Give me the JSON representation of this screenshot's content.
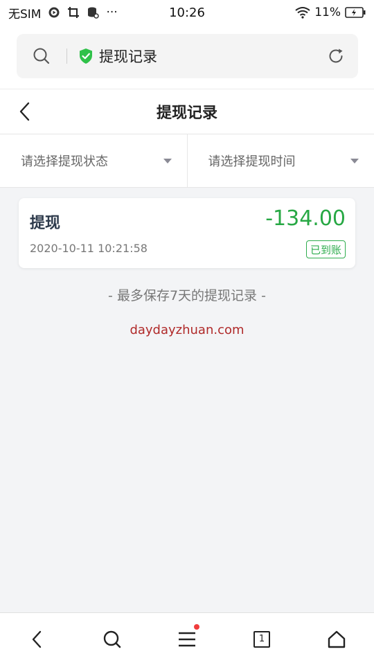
{
  "status_bar": {
    "carrier": "无SIM",
    "time": "10:26",
    "battery": "11%",
    "icons": [
      "media-icon",
      "screenshot-icon",
      "storage-icon",
      "more-dots-icon",
      "wifi-icon",
      "battery-charging-icon"
    ],
    "more": "···"
  },
  "browser": {
    "title": "提现记录",
    "icons": [
      "search-icon",
      "shield-check-icon",
      "reload-icon"
    ],
    "secure_color": "#2fc149"
  },
  "header": {
    "title": "提现记录",
    "back_icon": "chevron-left-icon"
  },
  "filters": [
    {
      "label": "请选择提现状态"
    },
    {
      "label": "请选择提现时间"
    }
  ],
  "records": [
    {
      "title": "提现",
      "amount": "-134.00",
      "time": "2020-10-11 10:21:58",
      "status": "已到账"
    }
  ],
  "note": "- 最多保存7天的提现记录 -",
  "watermark": "daydayzhuan.com",
  "colors": {
    "accent_green": "#27a844",
    "watermark_red": "#b02a2a",
    "background": "#f3f4f6"
  },
  "bottom_nav": {
    "tab_count": "1",
    "icons": [
      "back-icon",
      "search-icon",
      "menu-icon",
      "tabs-icon",
      "home-icon"
    ]
  }
}
